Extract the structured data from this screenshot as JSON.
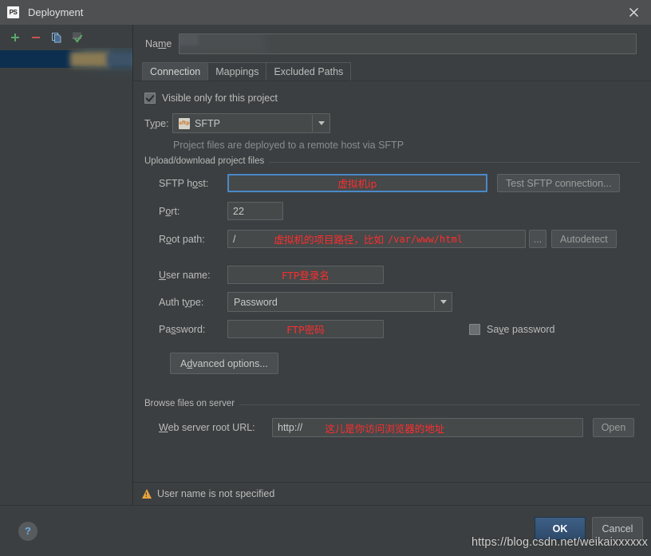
{
  "window": {
    "title": "Deployment",
    "app_icon": "PS",
    "close_icon": "close-icon"
  },
  "sidebar": {
    "toolbar": [
      {
        "name": "add-icon",
        "glyph": "+",
        "color": "#59a869"
      },
      {
        "name": "remove-icon",
        "glyph": "−",
        "color": "#c75450"
      },
      {
        "name": "copy-icon",
        "glyph": "copy",
        "color": "#5394ec"
      },
      {
        "name": "set-default-icon",
        "glyph": "check",
        "color": "#59a869"
      }
    ],
    "items": [
      {
        "label": "",
        "redacted": true,
        "selected": true
      }
    ]
  },
  "form": {
    "name_label_pre": "Na",
    "name_label_mnemonic": "m",
    "name_label_post": "e",
    "name_value": ""
  },
  "tabs": [
    {
      "label": "Connection",
      "active": true
    },
    {
      "label": "Mappings",
      "active": false
    },
    {
      "label": "Excluded Paths",
      "active": false
    }
  ],
  "connection": {
    "visible_only_checkbox": {
      "label": "Visible only for this project",
      "checked": true
    },
    "type": {
      "label_pre": "T",
      "label_mnemonic": "y",
      "label_post": "pe:",
      "value": "SFTP",
      "icon": "sftp-file-icon"
    },
    "type_hint": "Project files are deployed to a remote host via SFTP",
    "upload_group": {
      "title": "Upload/download project files",
      "sftp_host": {
        "label_pre": "SFTP h",
        "label_mnemonic": "o",
        "label_post": "st:",
        "annotation": "虚拟机ip",
        "focused": true
      },
      "test_button": {
        "label": "Test SFTP connection...",
        "enabled": false
      },
      "port": {
        "label_pre": "P",
        "label_mnemonic": "o",
        "label_post": "rt:",
        "value": "22"
      },
      "root_path": {
        "label_pre": "R",
        "label_mnemonic": "o",
        "label_post": "ot path:",
        "value": "/",
        "annotation": "虚拟机的项目路径，比如",
        "annotation_mono": "/var/www/html",
        "browse_button": "...",
        "autodetect_button": "Autodetect"
      },
      "user_name": {
        "label_pre": "",
        "label_mnemonic": "U",
        "label_post": "ser name:",
        "annotation": "FTP登录名"
      },
      "auth_type": {
        "label_pre": "Auth t",
        "label_mnemonic": "y",
        "label_post": "pe:",
        "value": "Password"
      },
      "password": {
        "label_pre": "Pa",
        "label_mnemonic": "s",
        "label_post": "sword:",
        "annotation": "FTP密码"
      },
      "save_password": {
        "label_pre": "Sa",
        "label_mnemonic": "v",
        "label_post": "e password",
        "checked": false
      }
    },
    "advanced_button": {
      "label_pre": "A",
      "label_mnemonic": "d",
      "label_post": "vanced options..."
    },
    "browse_group": {
      "title": "Browse files on server",
      "web_root_url": {
        "label_pre": "",
        "label_mnemonic": "W",
        "label_post": "eb server root URL:",
        "value": "http://",
        "annotation": "这儿是你访问浏览器的地址"
      },
      "open_button": {
        "label": "Open",
        "enabled": false
      }
    }
  },
  "warning": {
    "icon": "warning-triangle-icon",
    "text": "User name is not specified"
  },
  "footer": {
    "help": "?",
    "ok": "OK",
    "cancel": "Cancel"
  },
  "watermark": "https://blog.csdn.net/weikaixxxxxx",
  "colors": {
    "background": "#3c3f41",
    "titlebar": "#4e5052",
    "annotation_red": "#ff2d2d",
    "focus_blue": "#4a88c7",
    "selection_navy": "#0d2f4f",
    "warning_orange": "#e8a33d",
    "ok_blue": "#3e5f85"
  }
}
